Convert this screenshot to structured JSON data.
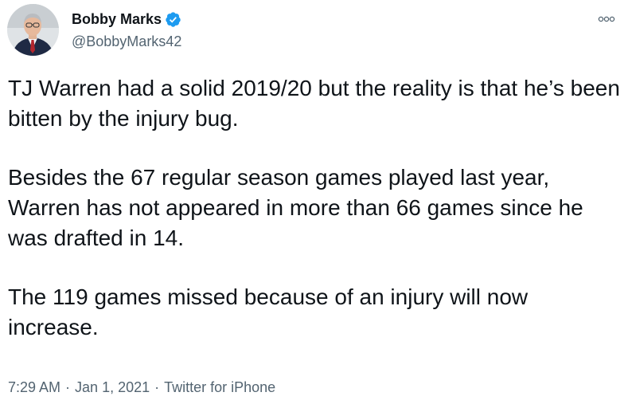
{
  "author": {
    "name": "Bobby Marks",
    "handle": "@BobbyMarks42",
    "verified": true,
    "avatar_icon": "profile-photo"
  },
  "tweet": {
    "paragraphs": [
      "TJ Warren had a solid 2019/20 but the reality is that he’s been bitten by the injury bug.",
      "Besides the 67 regular season games played last year, Warren has not appeared in more than 66 games since he was drafted in 14.",
      "The 119 games missed because of an injury will now increase."
    ]
  },
  "meta": {
    "time": "7:29 AM",
    "separator": "·",
    "date": "Jan 1, 2021",
    "source": "Twitter for iPhone"
  },
  "colors": {
    "verified_badge": "#1d9bf0",
    "secondary_text": "#536471",
    "primary_text": "#0f1419"
  },
  "icons": {
    "more": "more-options-icon",
    "verified": "verified-badge-icon"
  }
}
